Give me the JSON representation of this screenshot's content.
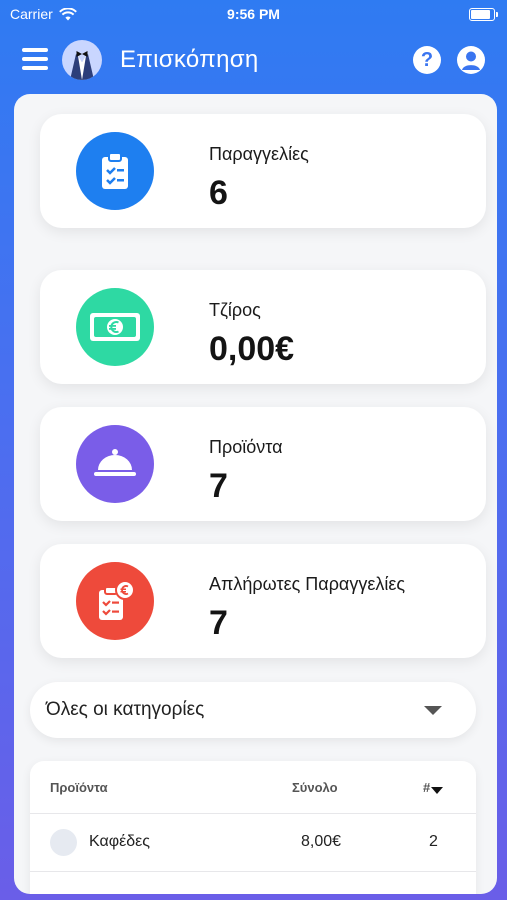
{
  "status_bar": {
    "carrier": "Carrier",
    "time": "9:56 PM"
  },
  "header": {
    "title": "Επισκόπηση",
    "help_symbol": "?"
  },
  "stats": [
    {
      "label": "Παραγγελίες",
      "value": "6",
      "icon": "clipboard-check-icon",
      "color": "#1e7ff0"
    },
    {
      "label": "Τζίρος",
      "value": "0,00€",
      "icon": "euro-banknote-icon",
      "color": "#2ed9a3"
    },
    {
      "label": "Προϊόντα",
      "value": "7",
      "icon": "serving-cloche-icon",
      "color": "#7a5de8"
    },
    {
      "label": "Απλήρωτες Παραγγελίες",
      "value": "7",
      "icon": "unpaid-clipboard-icon",
      "color": "#ee4a3b"
    }
  ],
  "filter": {
    "selected": "Όλες οι κατηγορίες"
  },
  "table": {
    "columns": [
      "Προϊόντα",
      "Σύνολο",
      "#"
    ],
    "rows": [
      {
        "name": "Καφέδες",
        "total": "8,00€",
        "count": "2"
      }
    ]
  }
}
